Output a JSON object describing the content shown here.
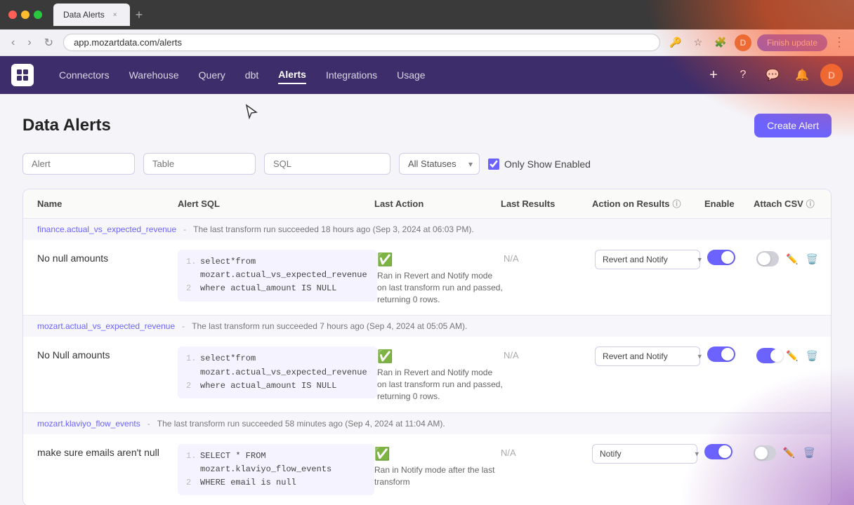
{
  "browser": {
    "tab_title": "Data Alerts",
    "url": "app.mozartdata.com/alerts",
    "finish_update": "Finish update"
  },
  "nav": {
    "logo": "m",
    "links": [
      "Connectors",
      "Warehouse",
      "Query",
      "dbt",
      "Alerts",
      "Integrations",
      "Usage"
    ],
    "active_link": "Alerts"
  },
  "page": {
    "title": "Data Alerts",
    "create_button": "Create Alert"
  },
  "filters": {
    "alert_placeholder": "Alert",
    "table_placeholder": "Table",
    "sql_placeholder": "SQL",
    "status_option": "All Statuses",
    "only_show_enabled": "Only Show Enabled"
  },
  "table": {
    "columns": [
      "Name",
      "Alert SQL",
      "Last Action",
      "Last Results",
      "Action on Results",
      "Enable",
      "Attach CSV"
    ],
    "groups": [
      {
        "name": "finance.actual_vs_expected_revenue",
        "separator": "-",
        "description": "The last transform run succeeded 18 hours ago (Sep 3, 2024 at 06:03 PM).",
        "alerts": [
          {
            "name": "No null amounts",
            "sql_lines": [
              {
                "num": "1.",
                "code": "select*from mozart.actual_vs_expected_revenue"
              },
              {
                "num": "2",
                "code": "where actual_amount IS NULL"
              }
            ],
            "last_action_status": "✓",
            "last_action_text": "Ran in Revert and Notify mode on last transform run and passed, returning 0 rows.",
            "last_results": "N/A",
            "action_on_results": "Revert and Notify",
            "enable_on": true,
            "attach_csv_on": false
          }
        ]
      },
      {
        "name": "mozart.actual_vs_expected_revenue",
        "separator": "-",
        "description": "The last transform run succeeded 7 hours ago (Sep 4, 2024 at 05:05 AM).",
        "alerts": [
          {
            "name": "No Null amounts",
            "sql_lines": [
              {
                "num": "1.",
                "code": "select*from mozart.actual_vs_expected_revenue"
              },
              {
                "num": "2",
                "code": "where actual_amount IS NULL"
              }
            ],
            "last_action_status": "✓",
            "last_action_text": "Ran in Revert and Notify mode on last transform run and passed, returning 0 rows.",
            "last_results": "N/A",
            "action_on_results": "Revert and Notify",
            "enable_on": true,
            "attach_csv_on": true
          }
        ]
      },
      {
        "name": "mozart.klaviyo_flow_events",
        "separator": "-",
        "description": "The last transform run succeeded 58 minutes ago (Sep 4, 2024 at 11:04 AM).",
        "alerts": [
          {
            "name": "make sure emails aren't null",
            "sql_lines": [
              {
                "num": "1.",
                "code": "SELECT * FROM mozart.klaviyo_flow_events"
              },
              {
                "num": "2",
                "code": "WHERE email is null"
              }
            ],
            "last_action_status": "✓",
            "last_action_text": "Ran in Notify mode after the last transform",
            "last_results": "N/A",
            "action_on_results": "Notify",
            "enable_on": true,
            "attach_csv_on": false
          }
        ]
      }
    ]
  }
}
